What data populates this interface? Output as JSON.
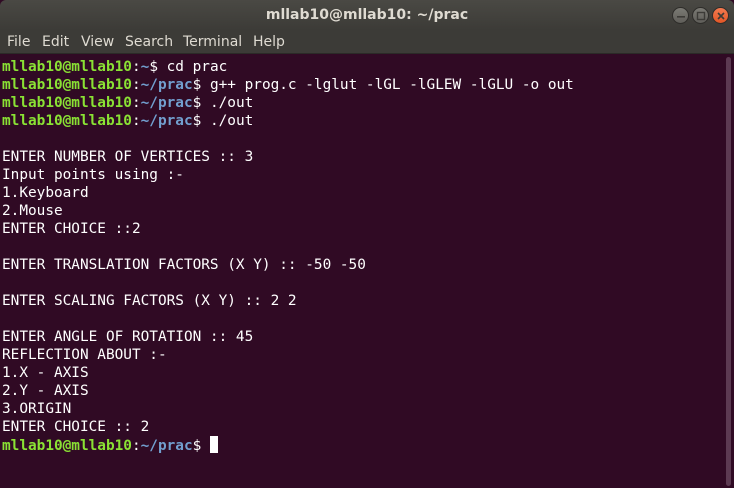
{
  "window": {
    "title": "mllab10@mllab10: ~/prac"
  },
  "menu": {
    "file": "File",
    "edit": "Edit",
    "view": "View",
    "search": "Search",
    "terminal": "Terminal",
    "help": "Help"
  },
  "prompt": {
    "user": "mllab10@mllab10",
    "colon": ":",
    "tilde": "~",
    "path": "~/prac",
    "dollar": "$"
  },
  "lines": {
    "cmd1": " cd prac",
    "cmd2": " g++ prog.c -lglut -lGL -lGLEW -lGLU -o out",
    "cmd3": " ./out",
    "cmd4": " ./out",
    "o1": "ENTER NUMBER OF VERTICES :: 3",
    "o2": "Input points using :-",
    "o3": "1.Keyboard",
    "o4": "2.Mouse",
    "o5": "ENTER CHOICE ::2",
    "o6": "ENTER TRANSLATION FACTORS (X Y) :: -50 -50",
    "o7": "ENTER SCALING FACTORS (X Y) :: 2 2",
    "o8": "ENTER ANGLE OF ROTATION :: 45",
    "o9": "REFLECTION ABOUT :-",
    "o10": "1.X - AXIS",
    "o11": "2.Y - AXIS",
    "o12": "3.ORIGIN",
    "o13": "ENTER CHOICE :: 2"
  },
  "colors": {
    "background": "#300a24",
    "prompt_user": "#8ae234",
    "prompt_path": "#729fcf",
    "text": "#ffffff"
  }
}
